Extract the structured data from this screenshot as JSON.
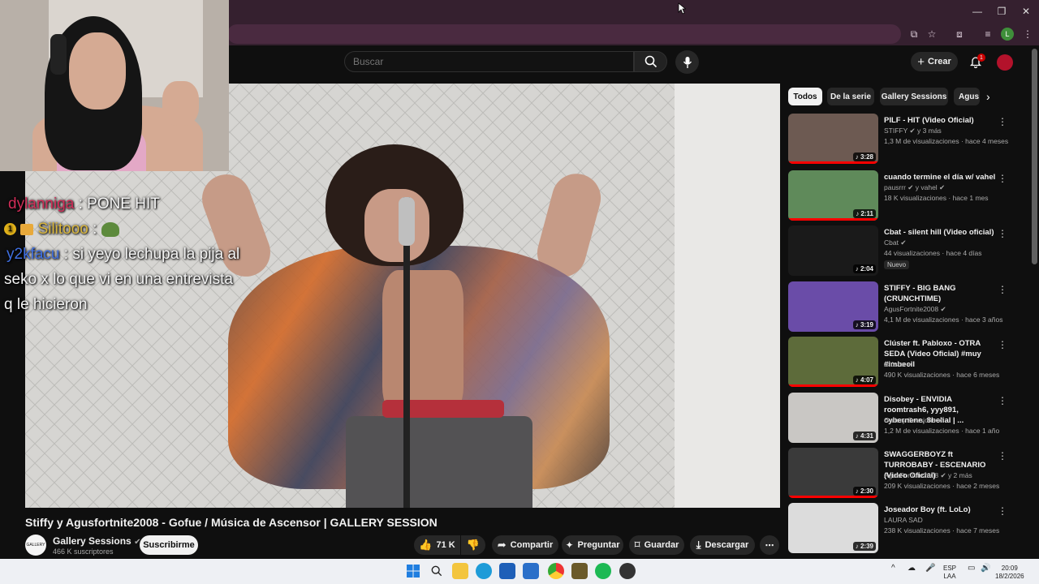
{
  "search": {
    "placeholder": "Buscar"
  },
  "header": {
    "create_label": "Crear",
    "notification_count": "1"
  },
  "chat": [
    {
      "user": "dylanniga",
      "user_color": "#d12d58",
      "message": " : PONE HIT"
    },
    {
      "user": "Silitooo",
      "user_color": "#d9b63c",
      "message": " : "
    },
    {
      "user": "y2kfacu",
      "user_color": "#3f6fe0",
      "message": " : si yeyo lechupa la pija al"
    },
    {
      "user": "",
      "user_color": "#ffffff",
      "message": "seko x lo que vi en una entrevista"
    },
    {
      "user": "",
      "user_color": "#ffffff",
      "message": "q le hicieron"
    }
  ],
  "video": {
    "title": "Stiffy y Agusfortnite2008 - Gofue / Música de Ascensor | GALLERY SESSION",
    "channel_name": "Gallery Sessions",
    "channel_avatar_text": "GALLERY",
    "subscribers": "466 K suscriptores",
    "subscribe_label": "Suscribirme",
    "likes": "71 K",
    "share_label": "Compartir",
    "ask_label": "Preguntar",
    "save_label": "Guardar",
    "download_label": "Descargar"
  },
  "chips": [
    "Todos",
    "De la serie",
    "Gallery Sessions",
    "Agus"
  ],
  "related": [
    {
      "title": "PILF - HIT (Video Oficial)",
      "channel": "STIFFY ✔ y 3 más",
      "meta": "1,3 M de visualizaciones · hace 4 meses",
      "duration": "3:28",
      "badge": "",
      "thumb_color": "#6d5a52"
    },
    {
      "title": "cuando termine el día w/ vahel",
      "channel": "pausrrr ✔ y vahel ✔",
      "meta": "18 K visualizaciones · hace 1 mes",
      "duration": "2:11",
      "badge": "",
      "thumb_color": "#5f8a5a"
    },
    {
      "title": "Cbat - silent hill (Video oficial)",
      "channel": "Cbat ✔",
      "meta": "44 visualizaciones · hace 4 días",
      "duration": "2:04",
      "badge": "Nuevo",
      "thumb_color": "#1a1a1a"
    },
    {
      "title": "STIFFY - BIG BANG (CRUNCHTIME)",
      "channel": "AgusFortnite2008 ✔",
      "meta": "4,1 M de visualizaciones · hace 3 años",
      "duration": "3:19",
      "badge": "",
      "thumb_color": "#6a4ca8"
    },
    {
      "title": "Clúster ft. Pabloxo - OTRA SEDA (Video Oficial) #muy #imbecil",
      "channel": "Clúster ✔",
      "meta": "490 K visualizaciones · hace 6 meses",
      "duration": "4:07",
      "badge": "",
      "thumb_color": "#5d6b3a"
    },
    {
      "title": "Disobey - ENVIDIA roomtrash6, yyy891, cybernene, 8belial | ...",
      "channel": "Gallery Sessions ✔",
      "meta": "1,2 M de visualizaciones · hace 1 año",
      "duration": "4:31",
      "badge": "",
      "thumb_color": "#c9c7c4"
    },
    {
      "title": "SWAGGERBOYZ ft TURROBABY - ESCENARIO (Video Oficial)",
      "channel": "AgusFortnite2008 ✔ y 2 más",
      "meta": "209 K visualizaciones · hace 2 meses",
      "duration": "2:30",
      "badge": "",
      "thumb_color": "#3a3a3a"
    },
    {
      "title": "Joseador Boy (ft. LoLo)",
      "channel": "LAURA SAD",
      "meta": "238 K visualizaciones · hace 7 meses",
      "duration": "2:39",
      "badge": "",
      "thumb_color": "#dcdcdc"
    }
  ],
  "tray": {
    "lang_top": "ESP",
    "lang_bottom": "LAA",
    "time": "20:09",
    "date": "18/2/2026"
  }
}
